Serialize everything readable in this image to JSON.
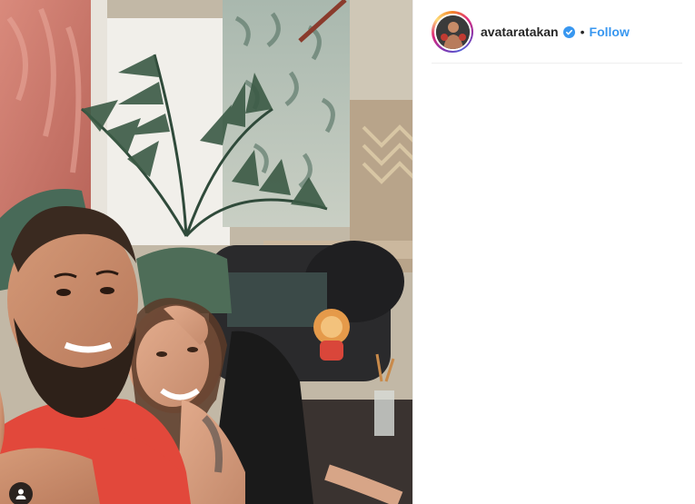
{
  "post": {
    "photo": {
      "description_icon": "user-tag-icon"
    },
    "header": {
      "username": "avataratakan",
      "verified_icon": "verified-badge-icon",
      "separator": "•",
      "follow_label": "Follow"
    }
  },
  "colors": {
    "follow_blue": "#3897f0",
    "text_dark": "#262626",
    "divider": "#efefef",
    "verified_blue": "#3897f0"
  }
}
